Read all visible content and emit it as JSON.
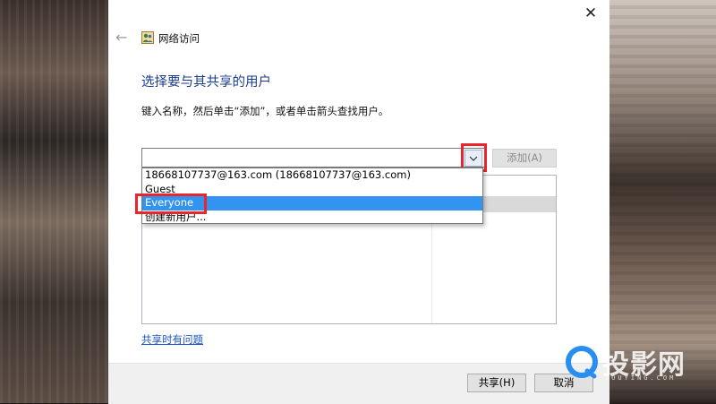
{
  "window": {
    "title": "网络访问"
  },
  "page": {
    "heading": "选择要与其共享的用户",
    "instruction": "键入名称，然后单击“添加”，或者单击箭头查找用户。"
  },
  "combo": {
    "value": "",
    "add_label": "添加(A)"
  },
  "dropdown": {
    "options": [
      "18668107737@163.com (18668107737@163.com)",
      "Guest",
      "Everyone",
      "创建新用户..."
    ],
    "selected": "Everyone"
  },
  "help_link": "共享时有问题",
  "footer": {
    "share_label": "共享(H)",
    "cancel_label": "取消"
  },
  "watermark": {
    "text": "投影网",
    "sub": "TOUYING.COM"
  },
  "colors": {
    "heading": "#1a3c8c",
    "highlight": "#3393f0",
    "annotation_red": "#e8262c",
    "link": "#1a55c8"
  }
}
